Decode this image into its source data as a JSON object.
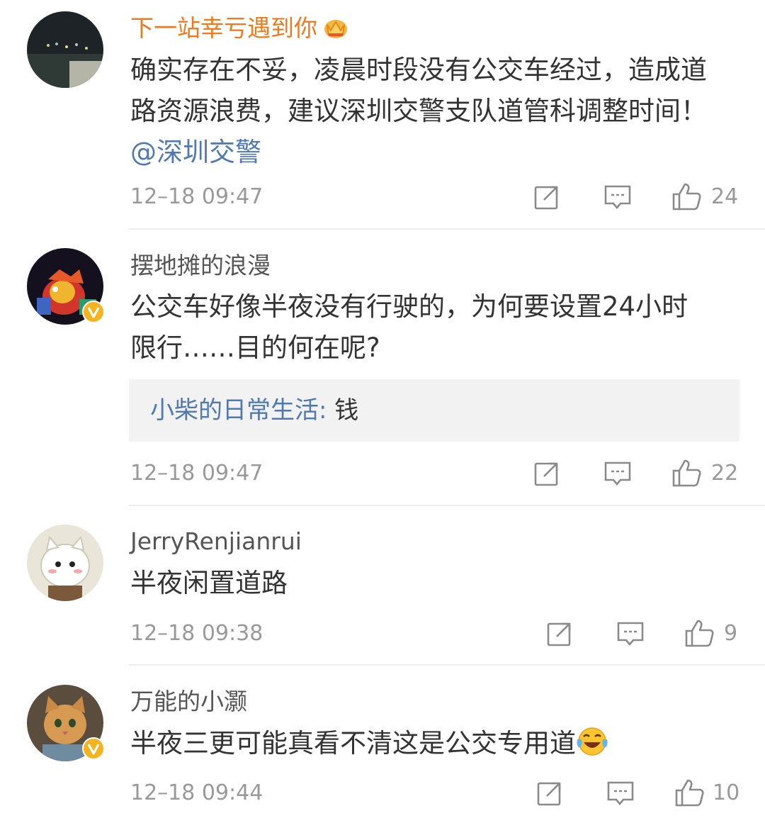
{
  "comments": [
    {
      "user": "下一站幸亏遇到你",
      "user_badge": "crown-icon",
      "text_lines": [
        "确实存在不妥，凌晨时段没有公交车经过，造成道",
        "路资源浪费，建议深圳交警支队道管科调整时间！"
      ],
      "mention": "@深圳交警",
      "time": "12–18 09:47",
      "likes": "24"
    },
    {
      "user": "摆地摊的浪漫",
      "verified": true,
      "text_lines": [
        "公交车好像半夜没有行驶的，为何要设置24小时",
        "限行……目的何在呢?"
      ],
      "reply": {
        "user": "小柴的日常生活",
        "separator": ":",
        "text": " 钱"
      },
      "time": "12–18 09:47",
      "likes": "22"
    },
    {
      "user": "JerryRenjianrui",
      "text_lines": [
        "半夜闲置道路"
      ],
      "time": "12–18 09:38",
      "likes": "9"
    },
    {
      "user": "万能的小灏",
      "verified": true,
      "text_lines": [
        "半夜三更可能真看不清这是公交专用道"
      ],
      "emoji": "laugh-cry-emoji",
      "time": "12–18 09:44",
      "likes": "10"
    }
  ],
  "colors": {
    "vip_name": "#ee7a1e",
    "mention": "#4f79b1",
    "verified_badge": "#f5b320",
    "muted": "#999999"
  }
}
